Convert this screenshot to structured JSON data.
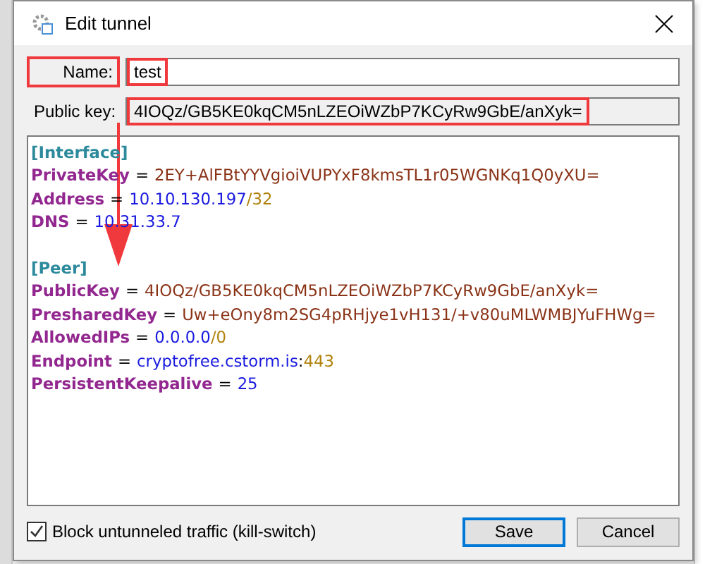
{
  "window": {
    "title": "Edit tunnel"
  },
  "name_field": {
    "label": "Name:",
    "value": "test",
    "highlighted": true
  },
  "public_key_field": {
    "label": "Public key:",
    "value": "4IOQz/GB5KE0kqCM5nLZEOiWZbP7KCyRw9GbE/anXyk=",
    "highlighted": true
  },
  "annotation_arrow": {
    "shown": true
  },
  "config_lines": [
    {
      "kind": "section",
      "text": "[Interface]"
    },
    {
      "kind": "pair",
      "key": "PrivateKey",
      "separator": "=",
      "value": [
        {
          "color": "#8a3317",
          "text": "2EY+AlFBtYYVgioiVUPYxF8kmsTL1r05WGNKq1Q0yXU="
        }
      ]
    },
    {
      "kind": "pair",
      "key": "Address",
      "separator": "=",
      "value": [
        {
          "color": "#1a1ae0",
          "text": "10.10.130.197"
        },
        {
          "color": "#b0820c",
          "text": "/32"
        }
      ]
    },
    {
      "kind": "pair",
      "key": "DNS",
      "separator": "=",
      "value": [
        {
          "color": "#1a1ae0",
          "text": "10.31.33.7"
        }
      ]
    },
    {
      "kind": "blank"
    },
    {
      "kind": "section",
      "text": "[Peer]"
    },
    {
      "kind": "pair",
      "key": "PublicKey",
      "separator": "=",
      "value": [
        {
          "color": "#8a3317",
          "text": "4IOQz/GB5KE0kqCM5nLZEOiWZbP7KCyRw9GbE/anXyk="
        }
      ]
    },
    {
      "kind": "pair",
      "key": "PresharedKey",
      "separator": "=",
      "value": [
        {
          "color": "#8a3317",
          "text": "Uw+eOny8m2SG4pRHjye1vH131/+v80uMLWMBJYuFHWg="
        }
      ]
    },
    {
      "kind": "pair",
      "key": "AllowedIPs",
      "separator": "=",
      "value": [
        {
          "color": "#1a1ae0",
          "text": "0.0.0.0"
        },
        {
          "color": "#b0820c",
          "text": "/0"
        }
      ]
    },
    {
      "kind": "pair",
      "key": "Endpoint",
      "separator": "=",
      "value": [
        {
          "color": "#1a1ae0",
          "text": "cryptofree.cstorm.is"
        },
        {
          "color": "#000000",
          "text": ":"
        },
        {
          "color": "#b0820c",
          "text": "443"
        }
      ]
    },
    {
      "kind": "pair",
      "key": "PersistentKeepalive",
      "separator": "=",
      "value": [
        {
          "color": "#1a1ae0",
          "text": "25"
        }
      ]
    }
  ],
  "kill_switch": {
    "label": "Block untunneled traffic (kill-switch)",
    "checked": true
  },
  "buttons": [
    {
      "label": "Save",
      "default": true
    },
    {
      "label": "Cancel",
      "default": false
    }
  ]
}
